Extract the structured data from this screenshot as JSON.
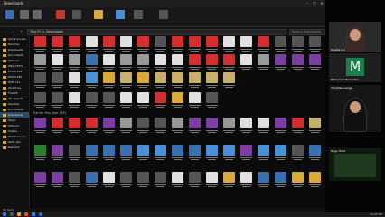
{
  "explorer": {
    "title": "Downloads",
    "path": "This PC > Downloads",
    "search_placeholder": "Search Downloads",
    "group_header": "Earlier this year (36)",
    "status": "80 items"
  },
  "sidebar": {
    "items": [
      "Quick access",
      "Desktop",
      "Downloads",
      "Documents",
      "Pictures",
      "ANALYTICS",
      "ECON 202",
      "ECON 280",
      "HIST 111",
      "OneDrive",
      "This PC",
      "3D Objects",
      "Desktop",
      "Documents",
      "Downloads",
      "Music",
      "Pictures",
      "Videos",
      "Windows (C:)",
      "DATA (D:)",
      "Network"
    ]
  },
  "video_panel": {
    "participants": [
      {
        "name": "Sophia Lin",
        "initial": ""
      },
      {
        "name": "Mohamed Hamedani",
        "initial": "M"
      },
      {
        "name": "Christian Lange",
        "initial": ""
      },
      {
        "name": "Hugo Hunt",
        "initial": ""
      }
    ]
  },
  "taskbar": {
    "clock": "10:24 PM"
  },
  "colors": {
    "accent": "#2d4a6b",
    "folder": "#d9a93a",
    "pdf": "#d32f2f",
    "rar": "#7b3fa0"
  }
}
